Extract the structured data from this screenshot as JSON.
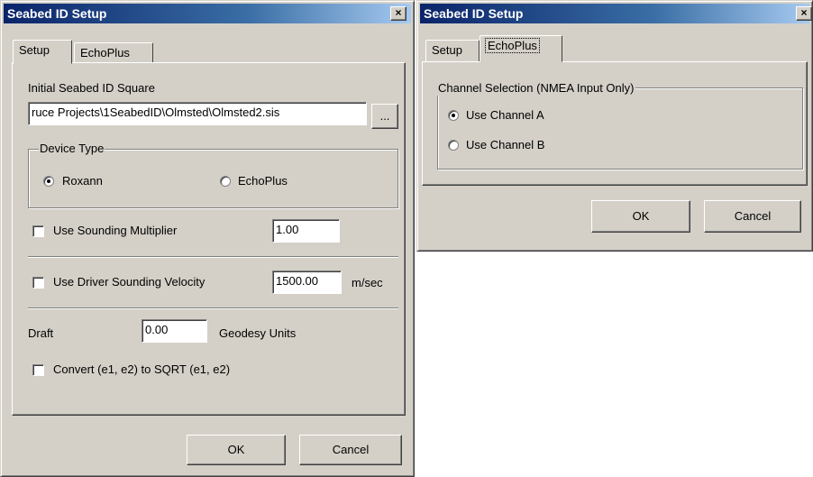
{
  "dialog1": {
    "title": "Seabed ID Setup",
    "close": "×",
    "tabs": [
      "Setup",
      "EchoPlus"
    ],
    "initial_label": "Initial Seabed ID Square",
    "initial_path": "ruce Projects\\1SeabedID\\Olmsted\\Olmsted2.sis",
    "browse": "...",
    "device_group": "Device Type",
    "radio_roxann": "Roxann",
    "radio_echoplus": "EchoPlus",
    "use_sounding_multiplier": "Use Sounding Multiplier",
    "multiplier_value": "1.00",
    "use_driver_velocity": "Use Driver Sounding Velocity",
    "velocity_value": "1500.00",
    "velocity_unit": "m/sec",
    "draft_label": "Draft",
    "draft_value": "0.00",
    "geodesy_units": "Geodesy Units",
    "convert_label": "Convert (e1, e2) to SQRT (e1, e2)",
    "ok": "OK",
    "cancel": "Cancel"
  },
  "dialog2": {
    "title": "Seabed ID Setup",
    "close": "×",
    "tabs": [
      "Setup",
      "EchoPlus"
    ],
    "channel_group": "Channel Selection (NMEA Input Only)",
    "channel_a": "Use Channel A",
    "channel_b": "Use Channel B",
    "ok": "OK",
    "cancel": "Cancel"
  }
}
